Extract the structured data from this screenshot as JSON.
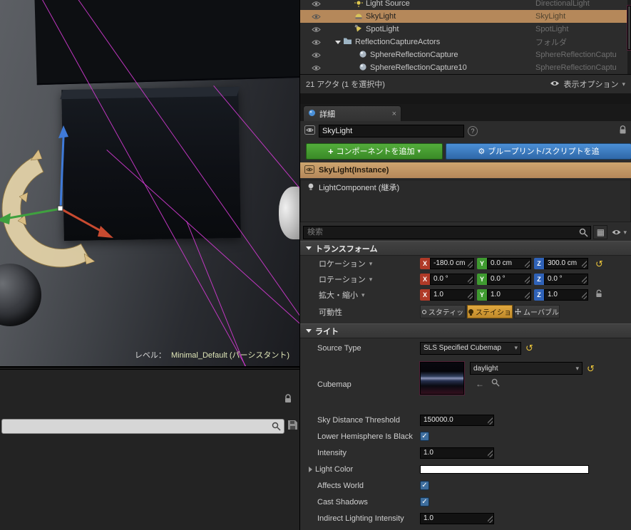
{
  "colors": {
    "selection_tan": "#b5885a",
    "button_green": "#3a8a27",
    "button_blue": "#2f68a8",
    "axis_x": "#b03a28",
    "axis_y": "#3f9b30",
    "axis_z": "#2f62b8",
    "mobility_selected": "#c08a2a",
    "magenta_wire": "#d23ad2",
    "reset_yellow": "#e8c23a"
  },
  "outliner": {
    "rows": [
      {
        "label": "Light Source",
        "type": "DirectionalLight"
      },
      {
        "label": "SkyLight",
        "type": "SkyLight",
        "selected": true
      },
      {
        "label": "SpotLight",
        "type": "SpotLight"
      },
      {
        "label": "ReflectionCaptureActors",
        "type": "フォルダ"
      },
      {
        "label": "SphereReflectionCapture",
        "type": "SphereReflectionCaptu"
      },
      {
        "label": "SphereReflectionCapture10",
        "type": "SphereReflectionCaptu"
      }
    ],
    "status": "21 アクタ (1 を選択中)",
    "view_options_label": "表示オプション"
  },
  "viewport": {
    "level_label": "レベル：",
    "level_name": "Minimal_Default (パーシスタント)"
  },
  "details": {
    "tab_label": "詳細",
    "name_value": "SkyLight",
    "buttons": {
      "add_component": "コンポーネントを追加",
      "blueprint": "ブループリント/スクリプトを追"
    },
    "instance_header": "SkyLight(Instance)",
    "component_label": "LightComponent (継承)",
    "search_placeholder": "検索",
    "transform_section": "トランスフォーム",
    "transform": {
      "location_label": "ロケーション",
      "rotation_label": "ロテーション",
      "scale_label": "拡大・縮小",
      "mobility_label": "可動性",
      "axis": {
        "x": "X",
        "y": "Y",
        "z": "Z"
      },
      "location": {
        "x": "-180.0 cm",
        "y": "0.0 cm",
        "z": "300.0 cm"
      },
      "rotation": {
        "x": "0.0 °",
        "y": "0.0 °",
        "z": "0.0 °"
      },
      "scale": {
        "x": "1.0",
        "y": "1.0",
        "z": "1.0"
      },
      "mobility": [
        "スタティッ",
        "ステイショ",
        "ムーバブル"
      ]
    },
    "light_section": "ライト",
    "light": {
      "source_type_label": "Source Type",
      "source_type_value": "SLS Specified Cubemap",
      "cubemap_label": "Cubemap",
      "cubemap_value": "daylight",
      "sky_distance_label": "Sky Distance Threshold",
      "sky_distance_value": "150000.0",
      "lower_hemisphere_label": "Lower Hemisphere Is Black",
      "intensity_label": "Intensity",
      "intensity_value": "1.0",
      "light_color_label": "Light Color",
      "affects_world_label": "Affects World",
      "cast_shadows_label": "Cast Shadows",
      "indirect_label": "Indirect Lighting Intensity",
      "indirect_value": "1.0"
    }
  }
}
